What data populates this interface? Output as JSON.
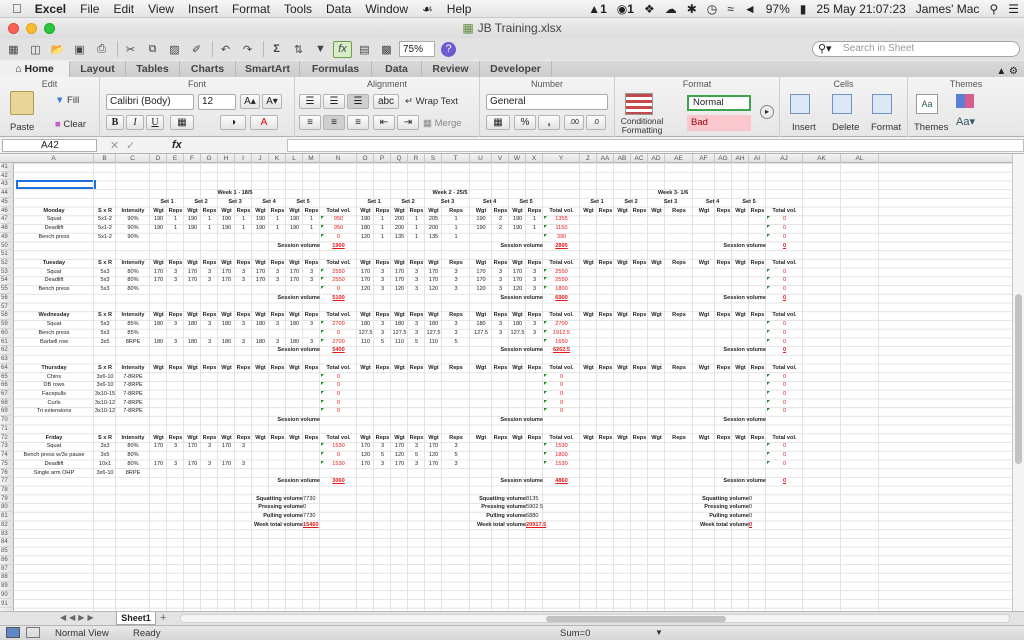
{
  "menubar": {
    "app": "Excel",
    "items": [
      "File",
      "Edit",
      "View",
      "Insert",
      "Format",
      "Tools",
      "Data",
      "Window",
      "Help"
    ],
    "right": [
      "1",
      "1",
      "97%",
      "25 May  21:07:23",
      "James' Mac"
    ]
  },
  "window": {
    "title": "JB Training.xlsx"
  },
  "toolbar": {
    "zoom": "75%",
    "search_placeholder": "Search in Sheet"
  },
  "tabs": [
    "Home",
    "Layout",
    "Tables",
    "Charts",
    "SmartArt",
    "Formulas",
    "Data",
    "Review",
    "Developer"
  ],
  "ribbon": {
    "groups": [
      "Edit",
      "Font",
      "Alignment",
      "Number",
      "Format",
      "Cells",
      "Themes"
    ],
    "paste": "Paste",
    "fill": "Fill",
    "clear": "Clear",
    "font": "Calibri (Body)",
    "size": "12",
    "wrap": "Wrap Text",
    "merge": "Merge",
    "number_format": "General",
    "cond_format": "Conditional",
    "cond_format2": "Formatting",
    "style_normal": "Normal",
    "style_bad": "Bad",
    "insert": "Insert",
    "delete": "Delete",
    "format": "Format",
    "themes": "Themes"
  },
  "formula": {
    "name_box": "A42",
    "fx": "fx"
  },
  "columns": [
    "A",
    "B",
    "C",
    "D",
    "E",
    "F",
    "G",
    "H",
    "I",
    "J",
    "K",
    "L",
    "M",
    "N",
    "O",
    "P",
    "Q",
    "R",
    "S",
    "T",
    "U",
    "V",
    "W",
    "X",
    "Y",
    "Z",
    "AA",
    "AB",
    "AC",
    "AD",
    "AE",
    "AF",
    "AG",
    "AH",
    "AI",
    "AJ",
    "AK",
    "AL"
  ],
  "row_start": 41,
  "row_count": 51,
  "sheet": {
    "tab": "Sheet1"
  },
  "status": {
    "view": "Normal View",
    "state": "Ready",
    "sum": "Sum=0"
  },
  "weeks": [
    {
      "title": "Week 1 - 18/5",
      "sets": [
        "Set 1",
        "Set 2",
        "Set 3",
        "Set 4",
        "Set 5"
      ]
    },
    {
      "title": "Week 2 - 25/5",
      "sets": [
        "Set 1",
        "Set 2",
        "Set 3",
        "Set 4",
        "Set 5"
      ]
    },
    {
      "title": "Week 3- 1/6",
      "sets": [
        "Set 1",
        "Set 2",
        "Set 3",
        "Set 4",
        "Set 5"
      ]
    }
  ],
  "labels": {
    "wgt": "Wgt",
    "reps": "Reps",
    "total": "Total vol.",
    "session": "Session volume",
    "sxr": "S x R",
    "intensity": "Intensity"
  },
  "days": [
    {
      "day": "Monday",
      "row": 46,
      "exercises": [
        {
          "name": "Squat",
          "sxr": "5x1-2",
          "int": "90%",
          "w1": [
            "190",
            "1",
            "190",
            "1",
            "190",
            "1",
            "190",
            "1",
            "190",
            "1"
          ],
          "t1": "950",
          "w2": [
            "190",
            "1",
            "200",
            "1",
            "205",
            "1",
            "190",
            "2",
            "190",
            "1"
          ],
          "t2": "1355",
          "t3": "0"
        },
        {
          "name": "Deadlift",
          "sxr": "5x1-2",
          "int": "90%",
          "w1": [
            "190",
            "1",
            "190",
            "1",
            "190",
            "1",
            "190",
            "1",
            "190",
            "1"
          ],
          "t1": "950",
          "w2": [
            "180",
            "1",
            "200",
            "1",
            "200",
            "1",
            "190",
            "2",
            "190",
            "1"
          ],
          "t2": "1150",
          "t3": "0"
        },
        {
          "name": "Bench press",
          "sxr": "5x1-2",
          "int": "90%",
          "w1": [],
          "t1": "0",
          "w2": [
            "120",
            "1",
            "135",
            "1",
            "135",
            "1"
          ],
          "t2": "390",
          "t3": "0"
        }
      ],
      "s1": "1900",
      "s2": "2895",
      "s3": "0"
    },
    {
      "day": "Tuesday",
      "row": 52,
      "exercises": [
        {
          "name": "Squat",
          "sxr": "5x3",
          "int": "80%",
          "w1": [
            "170",
            "3",
            "170",
            "3",
            "170",
            "3",
            "170",
            "3",
            "170",
            "3"
          ],
          "t1": "2550",
          "w2": [
            "170",
            "3",
            "170",
            "3",
            "170",
            "3",
            "170",
            "3",
            "170",
            "3"
          ],
          "t2": "2550",
          "t3": "0"
        },
        {
          "name": "Deadlift",
          "sxr": "5x3",
          "int": "80%",
          "w1": [
            "170",
            "3",
            "170",
            "3",
            "170",
            "3",
            "170",
            "3",
            "170",
            "3"
          ],
          "t1": "2550",
          "w2": [
            "170",
            "3",
            "170",
            "3",
            "170",
            "3",
            "170",
            "3",
            "170",
            "3"
          ],
          "t2": "2550",
          "t3": "0"
        },
        {
          "name": "Bench press",
          "sxr": "5x3",
          "int": "80%",
          "w1": [],
          "t1": "0",
          "w2": [
            "120",
            "3",
            "120",
            "3",
            "120",
            "3",
            "120",
            "3",
            "120",
            "3"
          ],
          "t2": "1800",
          "t3": "0"
        }
      ],
      "s1": "5100",
      "s2": "6900",
      "s3": "0"
    },
    {
      "day": "Wednesday",
      "row": 58,
      "exercises": [
        {
          "name": "Squat",
          "sxr": "5x3",
          "int": "85%",
          "w1": [
            "180",
            "3",
            "180",
            "3",
            "180",
            "3",
            "180",
            "3",
            "180",
            "3"
          ],
          "t1": "2700",
          "w2": [
            "180",
            "3",
            "180",
            "3",
            "180",
            "3",
            "180",
            "3",
            "180",
            "3"
          ],
          "t2": "2700",
          "t3": "0"
        },
        {
          "name": "Bench press",
          "sxr": "5x3",
          "int": "85%",
          "w1": [],
          "t1": "0",
          "w2": [
            "127.5",
            "3",
            "127.5",
            "3",
            "127.5",
            "3",
            "127.5",
            "3",
            "127.5",
            "3"
          ],
          "t2": "1912.5",
          "t3": "0"
        },
        {
          "name": "Barbell row",
          "sxr": "3x5",
          "int": "8RPE",
          "w1": [
            "180",
            "3",
            "180",
            "3",
            "180",
            "3",
            "180",
            "3",
            "180",
            "3"
          ],
          "t1": "2700",
          "w2": [
            "110",
            "5",
            "110",
            "5",
            "110",
            "5"
          ],
          "t2": "1650",
          "t3": "0"
        }
      ],
      "s1": "5400",
      "s2": "6262.5",
      "s3": "0"
    },
    {
      "day": "Thursday",
      "row": 64,
      "exercises": [
        {
          "name": "Chins",
          "sxr": "3x6-10",
          "int": "7-8RPE",
          "w1": [],
          "t1": "0",
          "w2": [],
          "t2": "0",
          "t3": "0"
        },
        {
          "name": "DB rows",
          "sxr": "3x6-10",
          "int": "7-8RPE",
          "w1": [],
          "t1": "0",
          "w2": [],
          "t2": "0",
          "t3": "0"
        },
        {
          "name": "Facepulls",
          "sxr": "3x10-15",
          "int": "7-8RPE",
          "w1": [],
          "t1": "0",
          "w2": [],
          "t2": "0",
          "t3": "0"
        },
        {
          "name": "Curls",
          "sxr": "3x10-12",
          "int": "7-8RPE",
          "w1": [],
          "t1": "0",
          "w2": [],
          "t2": "0",
          "t3": "0"
        },
        {
          "name": "Tri extensions",
          "sxr": "3x10-12",
          "int": "7-8RPE",
          "w1": [],
          "t1": "0",
          "w2": [],
          "t2": "0",
          "t3": "0"
        }
      ],
      "s1": "",
      "s2": "",
      "s3": ""
    },
    {
      "day": "Friday",
      "row": 72,
      "exercises": [
        {
          "name": "Squat",
          "sxr": "3x3",
          "int": "80%",
          "w1": [
            "170",
            "3",
            "170",
            "3",
            "170",
            "3"
          ],
          "t1": "1530",
          "w2": [
            "170",
            "3",
            "170",
            "3",
            "170",
            "3"
          ],
          "t2": "1530",
          "t3": "0"
        },
        {
          "name": "Bench press w/3s pause",
          "sxr": "3x5",
          "int": "80%",
          "w1": [],
          "t1": "0",
          "w2": [
            "120",
            "5",
            "120",
            "5",
            "120",
            "5"
          ],
          "t2": "1800",
          "t3": "0"
        },
        {
          "name": "Deadlift",
          "sxr": "10x1",
          "int": "80%",
          "w1": [
            "170",
            "3",
            "170",
            "3",
            "170",
            "3"
          ],
          "t1": "1530",
          "w2": [
            "170",
            "3",
            "170",
            "3",
            "170",
            "3"
          ],
          "t2": "1530",
          "t3": "0"
        },
        {
          "name": "Single arm OHP",
          "sxr": "3x6-10",
          "int": "8RPE",
          "w1": [],
          "t1": "",
          "w2": [],
          "t2": "",
          "t3": ""
        }
      ],
      "s1": "3060",
      "s2": "4860",
      "s3": "0"
    }
  ],
  "summary": {
    "labels": [
      "Squatting volume",
      "Pressing volume",
      "Pulling volume",
      "Week total volume"
    ],
    "w1": [
      "7730",
      "0",
      "7730",
      "15460"
    ],
    "w2": [
      "8135",
      "5902.5",
      "6880",
      "20917.5"
    ],
    "w3": [
      "0",
      "0",
      "0",
      "0"
    ]
  }
}
